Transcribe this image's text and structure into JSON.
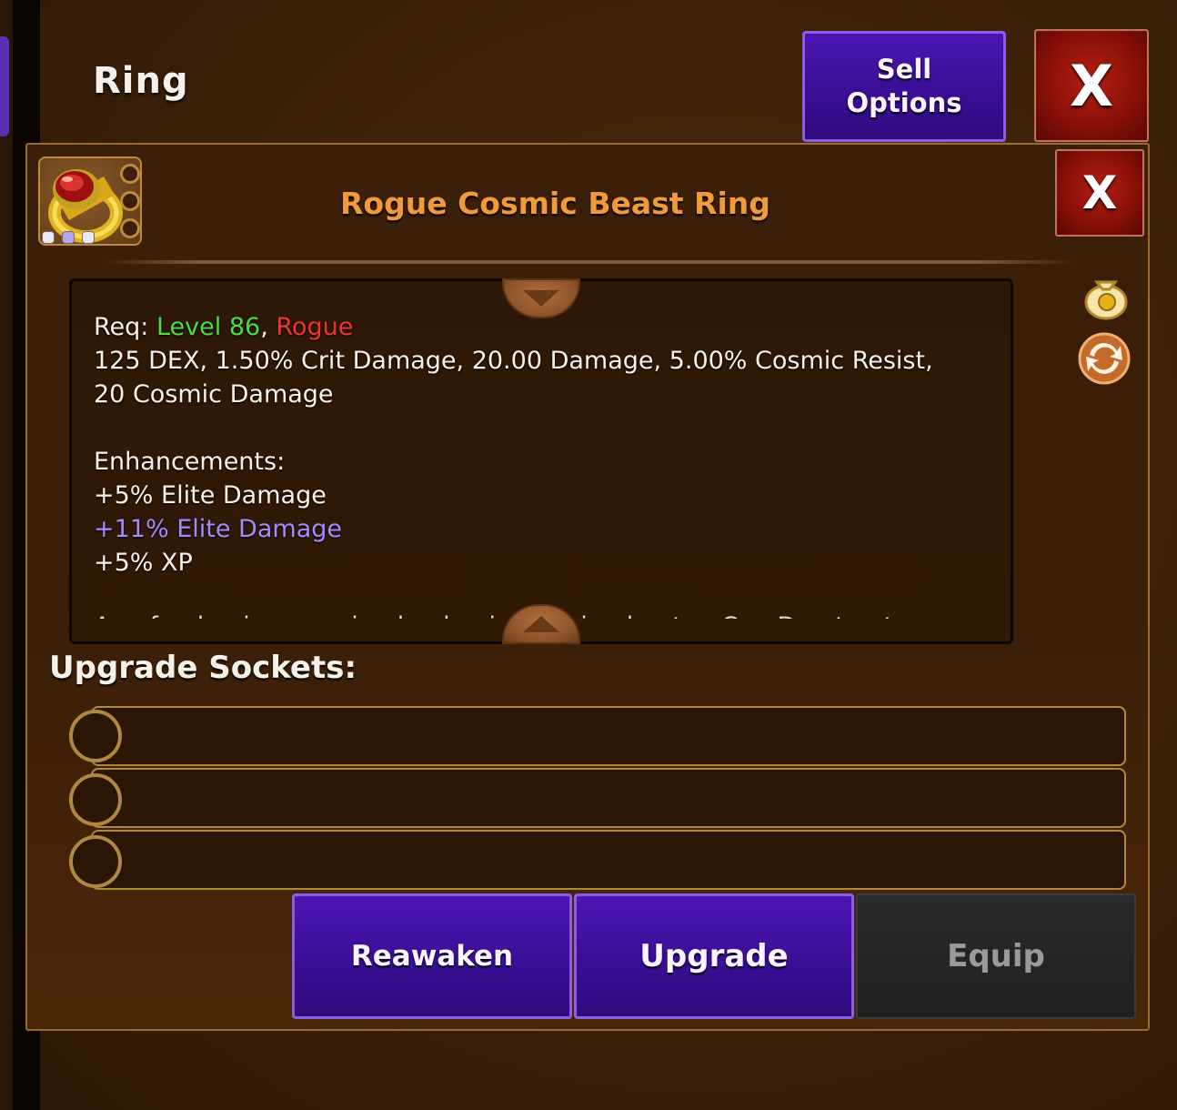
{
  "header": {
    "title": "Ring",
    "sell_label_line1": "Sell",
    "sell_label_line2": "Options",
    "close_label": "X"
  },
  "item": {
    "name": "Rogue Cosmic Beast Ring",
    "close_label": "X",
    "icon": "red-gem-gold-ring-icon",
    "socket_slots": 3,
    "gem_colors": [
      "#e8e8f0",
      "#b0a8f0",
      "#e8e8f0"
    ],
    "name_color": "#f09a3c"
  },
  "description": {
    "req_prefix": "Req: ",
    "req_level": "Level 86",
    "req_separator": ", ",
    "req_class": "Rogue",
    "stats_line1": "125 DEX, 1.50% Crit Damage, 20.00 Damage, 5.00% Cosmic Resist,",
    "stats_line2": "20 Cosmic Damage",
    "enhancements_title": "Enhancements:",
    "enhancements": [
      "+5% Elite Damage",
      "+11% Elite Damage",
      "+5% XP"
    ],
    "cut_off_line": "A ... f ... l ... i ... ... ... i ... l ... l ... i ... l ... i ... l ... t ... C ... D ... t ... t"
  },
  "side_icons": [
    "money-bag-icon",
    "refresh-exchange-icon"
  ],
  "sockets": {
    "label": "Upgrade Sockets:",
    "rows": [
      "",
      "",
      ""
    ]
  },
  "actions": {
    "reawaken": "Reawaken",
    "upgrade": "Upgrade",
    "equip": "Equip"
  }
}
